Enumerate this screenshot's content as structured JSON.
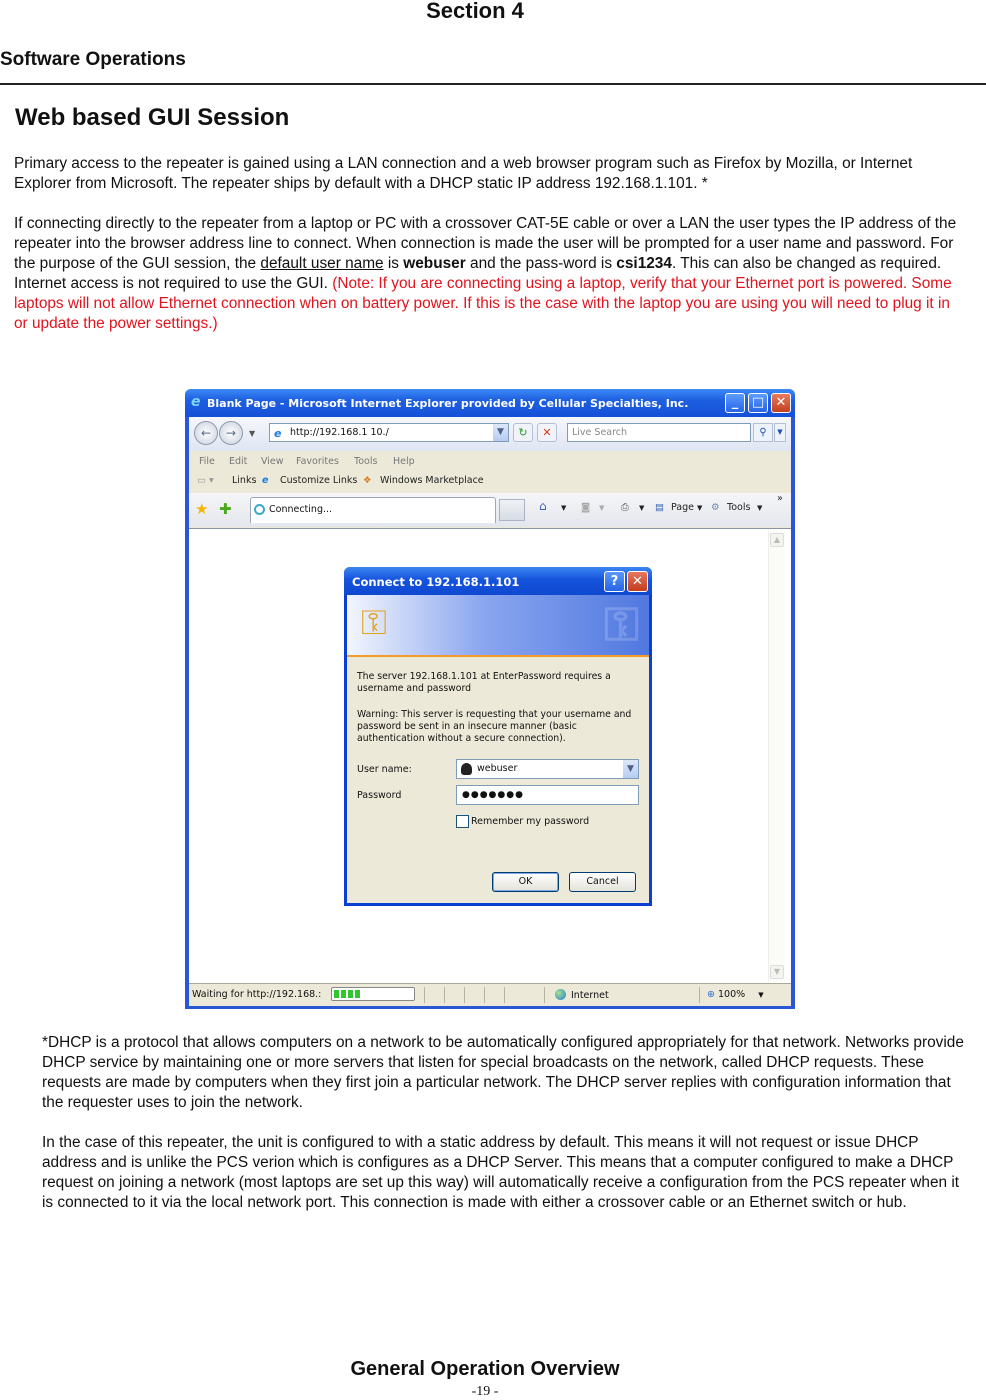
{
  "header": {
    "section": "Section 4",
    "subsection": "Software Operations",
    "page_heading": "Web based GUI Session"
  },
  "body": {
    "p1": "Primary access to the repeater is  gained using a LAN connection and a web browser program such as Firefox by Mozilla, or Internet Explorer from Microsoft.  The repeater ships by default with a DHCP static IP address 192.168.1.101. *",
    "p2_a": "If connecting directly to the repeater from a laptop or PC with a crossover CAT-5E cable or over a LAN the user types the IP address of the repeater into the browser address line to connect.   When connection is made the user will be prompted for a user name and password. For the purpose of the GUI session, the ",
    "p2_u": "default user name",
    "p2_b": " is ",
    "p2_user": "webuser",
    "p2_c": " and the pass-word is ",
    "p2_pass": "csi1234",
    "p2_d": ".  This can also be changed as required. Internet access is not required to use the GUI.  ",
    "p2_note": "(Note: If you are connecting using a laptop, verify that your Ethernet port is powered.  Some laptops will not allow Ethernet connection when on battery power. If this is the case with the laptop you are using you will need to plug it in or update the power settings.)",
    "accent_color": "#e0141e"
  },
  "browser": {
    "window_title": "Blank Page - Microsoft Internet Explorer provided by Cellular Specialties, Inc.",
    "address": "http://192.168.1 10./",
    "search_placeholder": "Live Search",
    "menu": [
      "File",
      "Edit",
      "View",
      "Favorites",
      "Tools",
      "Help"
    ],
    "links_label": "Links",
    "links": [
      "Customize Links",
      "Windows Marketplace"
    ],
    "tab_label": "Connecting...",
    "page_label": "Page",
    "tools_label": "Tools",
    "more": "»",
    "status_text": "Waiting for http://192.168.:",
    "progress": 0.35,
    "zone": "Internet",
    "zoom": "100%"
  },
  "dialog": {
    "title": "Connect to 192.168.1.101",
    "help": "?",
    "close": "✕",
    "message": "The server 192.168.1.101 at EnterPassword requires a username and password",
    "warning": "Warning: This server is requesting that your username and password be sent in an insecure manner (basic authentication without a secure connection).",
    "username_label": "User name:",
    "username_value": "webuser",
    "password_label": "Password",
    "password_value": "●●●●●●●",
    "remember_label": "Remember my password",
    "remember_checked": false,
    "ok_label": "OK",
    "cancel_label": "Cancel"
  },
  "footnotes": {
    "fn1": "*DHCP is a protocol that allows computers on a network to be automatically configured appropriately for that network. Networks provide DHCP service by maintaining one or more servers that listen for special broadcasts on the network, called DHCP requests.  These requests are made by computers when they first join a particular network.  The DHCP server replies with configuration information that the requester uses to join the network.",
    "fn2": "In the case of this repeater, the unit is configured to with a static address by default. This means it will not request or issue DHCP address and is unlike the PCS verion which is configures as a DHCP Server.  This means that a computer configured to make a DHCP request on joining a network (most laptops are set up this way) will automatically receive a configuration from the PCS repeater when it is connected to it via the local network port.  This connection is made with either a crossover cable or an Ethernet switch or hub."
  },
  "footer": {
    "title": "General Operation Overview",
    "page": "-19 -"
  }
}
